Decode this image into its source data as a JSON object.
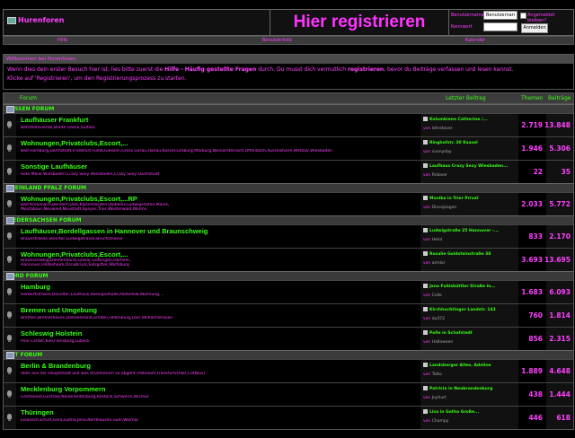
{
  "header": {
    "site_name": "Hurenforen",
    "register_label": "Hier registrieren",
    "login": {
      "username_label": "Benutzername",
      "username_value": "Benutzernam",
      "password_label": "Kennwort",
      "remember_label": "Angemeldet bleiben?",
      "submit_label": "Anmelden"
    }
  },
  "nav": {
    "items": [
      "Hilfe",
      "Benutzerliste",
      "Kalender"
    ]
  },
  "welcome": {
    "title": "Willkommen bei Hurenforen.",
    "text_1": "Wenn dies dein erster Besuch hier ist, lies bitte zuerst die",
    "help_link": "Hilfe - Häufig gestellte Fragen",
    "text_2": "durch. Du musst dich vermutlich",
    "register_link": "registrieren",
    "text_3": ", bevor du Beiträge verfassen und lesen kannst.",
    "text_4": "Klicke auf 'Registrieren', um den Registrierungsprozess zu starten."
  },
  "table_headers": {
    "forum": "Forum",
    "last_post": "Letzter Beitrag",
    "threads": "Themen",
    "posts": "Beiträge"
  },
  "categories": [
    {
      "title": "HESSEN FORUM",
      "forums": [
        {
          "title": "Laufhäuser Frankfurt",
          "desc": "Bahnhofsviertel,Breite Gasse,Sulfass",
          "last_title": "Kolumbiene Catherine /...",
          "last_by": "von",
          "last_user": "lehrstover",
          "threads": "2.719",
          "posts": "13.848"
        },
        {
          "title": "Wohnungen,Privatclubs,Escort,...",
          "desc": "Bad Homburg,Darmstadt,Frankfurt,Fulda,Giessen,Gross Gerau,Hanau,Kassel,Limburg,Marburg,Neckarsteinach,Offenbach,Rüsselsheim,Wetzlar,Wiesbaden",
          "last_title": "Ringhofstr. 30 Kassel",
          "last_by": "von",
          "last_user": "sunnyday",
          "threads": "1.946",
          "posts": "5.306"
        },
        {
          "title": "Sonstige Laufhäuser",
          "desc": "Rote Meile Wiesbaden,Crazy Sexy Wiesbaden,Crazy Sexy Darmstadt",
          "last_title": "Laufhaus Crazy Sexy Wiesbaden...",
          "last_by": "von",
          "last_user": "Ridover",
          "threads": "22",
          "posts": "35"
        }
      ]
    },
    {
      "title": "RHEINLAND PFALZ FORUM",
      "forums": [
        {
          "title": "Wohnungen,Privatclubs,Escort,...RP",
          "desc": "Bad Kreuznach,Bendorf,Dies,Kaiserslautern,Koblenz,Ludwigshafen,Mainz,",
          "desc2": "Montabaur,Neuwied,Neustadt,Speyer,Trier,Westerwald,Worms",
          "last_title": "Monika in Trier Privat",
          "last_by": "von",
          "last_user": "Discojoogen",
          "threads": "2.033",
          "posts": "5.772"
        }
      ]
    },
    {
      "title": "NIEDERSACHSEN FORUM",
      "forums": [
        {
          "title": "Laufhäuser,Bordellgassen in Hannover und Braunschweig",
          "desc": "Braunstraese,Steintor,Ludwigstrasse,Bruchstrasse",
          "last_title": "Ludwigstraße 25 Hannover -...",
          "last_by": "von",
          "last_user": "Heinl",
          "threads": "833",
          "posts": "2.170"
        },
        {
          "title": "Wohnungen,Privatclubs,Escort,...",
          "desc": "Braunschweig,Delmenhorst,Goslar,Göttingen,Hameln,",
          "desc2": "Hannover,Hildesheim,Osnabrück,Salzgitter,Wolfsburg",
          "last_title": "Rosalie Goldsteinstraße 38",
          "last_by": "von",
          "last_user": "armlor",
          "threads": "3.693",
          "posts": "13.695"
        }
      ]
    },
    {
      "title": "NORD FORUM",
      "forums": [
        {
          "title": "Hamburg",
          "desc": "Herbertstrasse,Davidtor,Laufhaus,Reesapolhalle,Pastellow,Wohnung,...",
          "last_title": "Jana Fuhlsbüttler Straße in...",
          "last_by": "von",
          "last_user": "Colle",
          "threads": "1.683",
          "posts": "6.093"
        },
        {
          "title": "Bremen und Umgebung",
          "desc": "Bremen,Bremerhaven,Delmenhorst,Emden,Oldenburg,Leer,Wilhelmshaven",
          "last_title": "Kirchhuchtinger Landstr. 143",
          "last_by": "von",
          "last_user": "du372",
          "threads": "760",
          "posts": "1.814"
        },
        {
          "title": "Schleswig Holstein",
          "desc": "Pine Center,Kiel,Flensburg,Lübeck",
          "last_title": "Polle in Schafstedt",
          "last_by": "von",
          "last_user": "Halloween",
          "threads": "856",
          "posts": "2.315"
        }
      ]
    },
    {
      "title": "OST FORUM",
      "forums": [
        {
          "title": "Berlin & Brandenburg",
          "desc": "Alles aus der Hauptstadt und was drumherum so abgeht (Potsdam,Frankfurt/Oder,Cottbus)",
          "last_title": "Landsberger Allee, Adeline",
          "last_by": "von",
          "last_user": "Totto",
          "threads": "1.889",
          "posts": "4.648"
        },
        {
          "title": "Mecklenburg Vorpommern",
          "desc": "Greifswald,Güstrow,Neubrandenburg,Rostock,Schwerin,Wismar",
          "last_title": "Patricia in Neubrandenburg",
          "last_by": "von",
          "last_user": "Joyhurt",
          "threads": "438",
          "posts": "1.444"
        },
        {
          "title": "Thüringen",
          "desc": "Eisenach,Erfurt,Gera,Gotha,Jena,Nordhausen,Suhl,Weimar",
          "last_title": "Lisa in Gotha Große...",
          "last_by": "von",
          "last_user": "Champy",
          "threads": "446",
          "posts": "618"
        }
      ]
    }
  ]
}
